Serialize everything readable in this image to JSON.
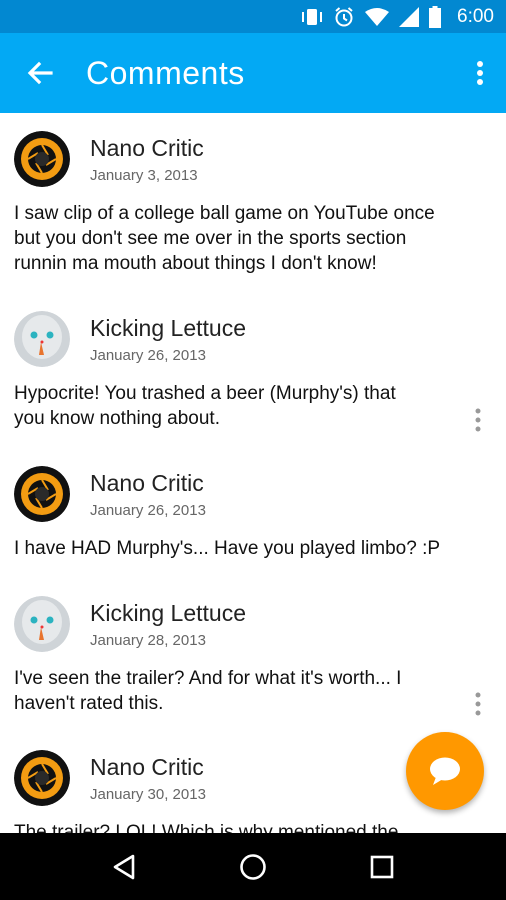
{
  "status_bar": {
    "time": "6:00",
    "icons": [
      "vibrate-icon",
      "alarm-icon",
      "wifi-icon",
      "signal-icon",
      "battery-icon"
    ]
  },
  "app_bar": {
    "title": "Comments",
    "back_icon": "arrow-back-icon",
    "menu_icon": "more-vert-icon"
  },
  "colors": {
    "status_bar": "#0288d1",
    "app_bar": "#03a9f4",
    "fab": "#ff9800",
    "nav_bar": "#000000"
  },
  "comments": [
    {
      "author": "Nano Critic",
      "date": "January 3, 2013",
      "avatar": "aperture-avatar",
      "lines": [
        "I saw clip of a college ball game on YouTube once",
        "but you don't see me over in the sports section",
        "runnin ma mouth about things I don't know!"
      ]
    },
    {
      "author": "Kicking Lettuce",
      "date": "January 26, 2013",
      "avatar": "plush-avatar",
      "lines": [
        "Hypocrite! You trashed a beer (Murphy's) that",
        "you know nothing about."
      ]
    },
    {
      "author": "Nano Critic",
      "date": "January 26, 2013",
      "avatar": "aperture-avatar",
      "lines": [
        "I have HAD Murphy's... Have you played limbo? :P"
      ]
    },
    {
      "author": "Kicking Lettuce",
      "date": "January 28, 2013",
      "avatar": "plush-avatar",
      "lines": [
        "I've seen the trailer? And for what it's worth... I",
        "haven't rated this."
      ]
    },
    {
      "author": "Nano Critic",
      "date": "January 30, 2013",
      "avatar": "aperture-avatar",
      "lines": [
        "The trailer?  LOL! Which is why mentioned the"
      ]
    }
  ],
  "fab": {
    "icon": "chat-bubble-icon"
  },
  "nav_bar": {
    "buttons": [
      "back-triangle-icon",
      "home-circle-icon",
      "recents-square-icon"
    ]
  }
}
